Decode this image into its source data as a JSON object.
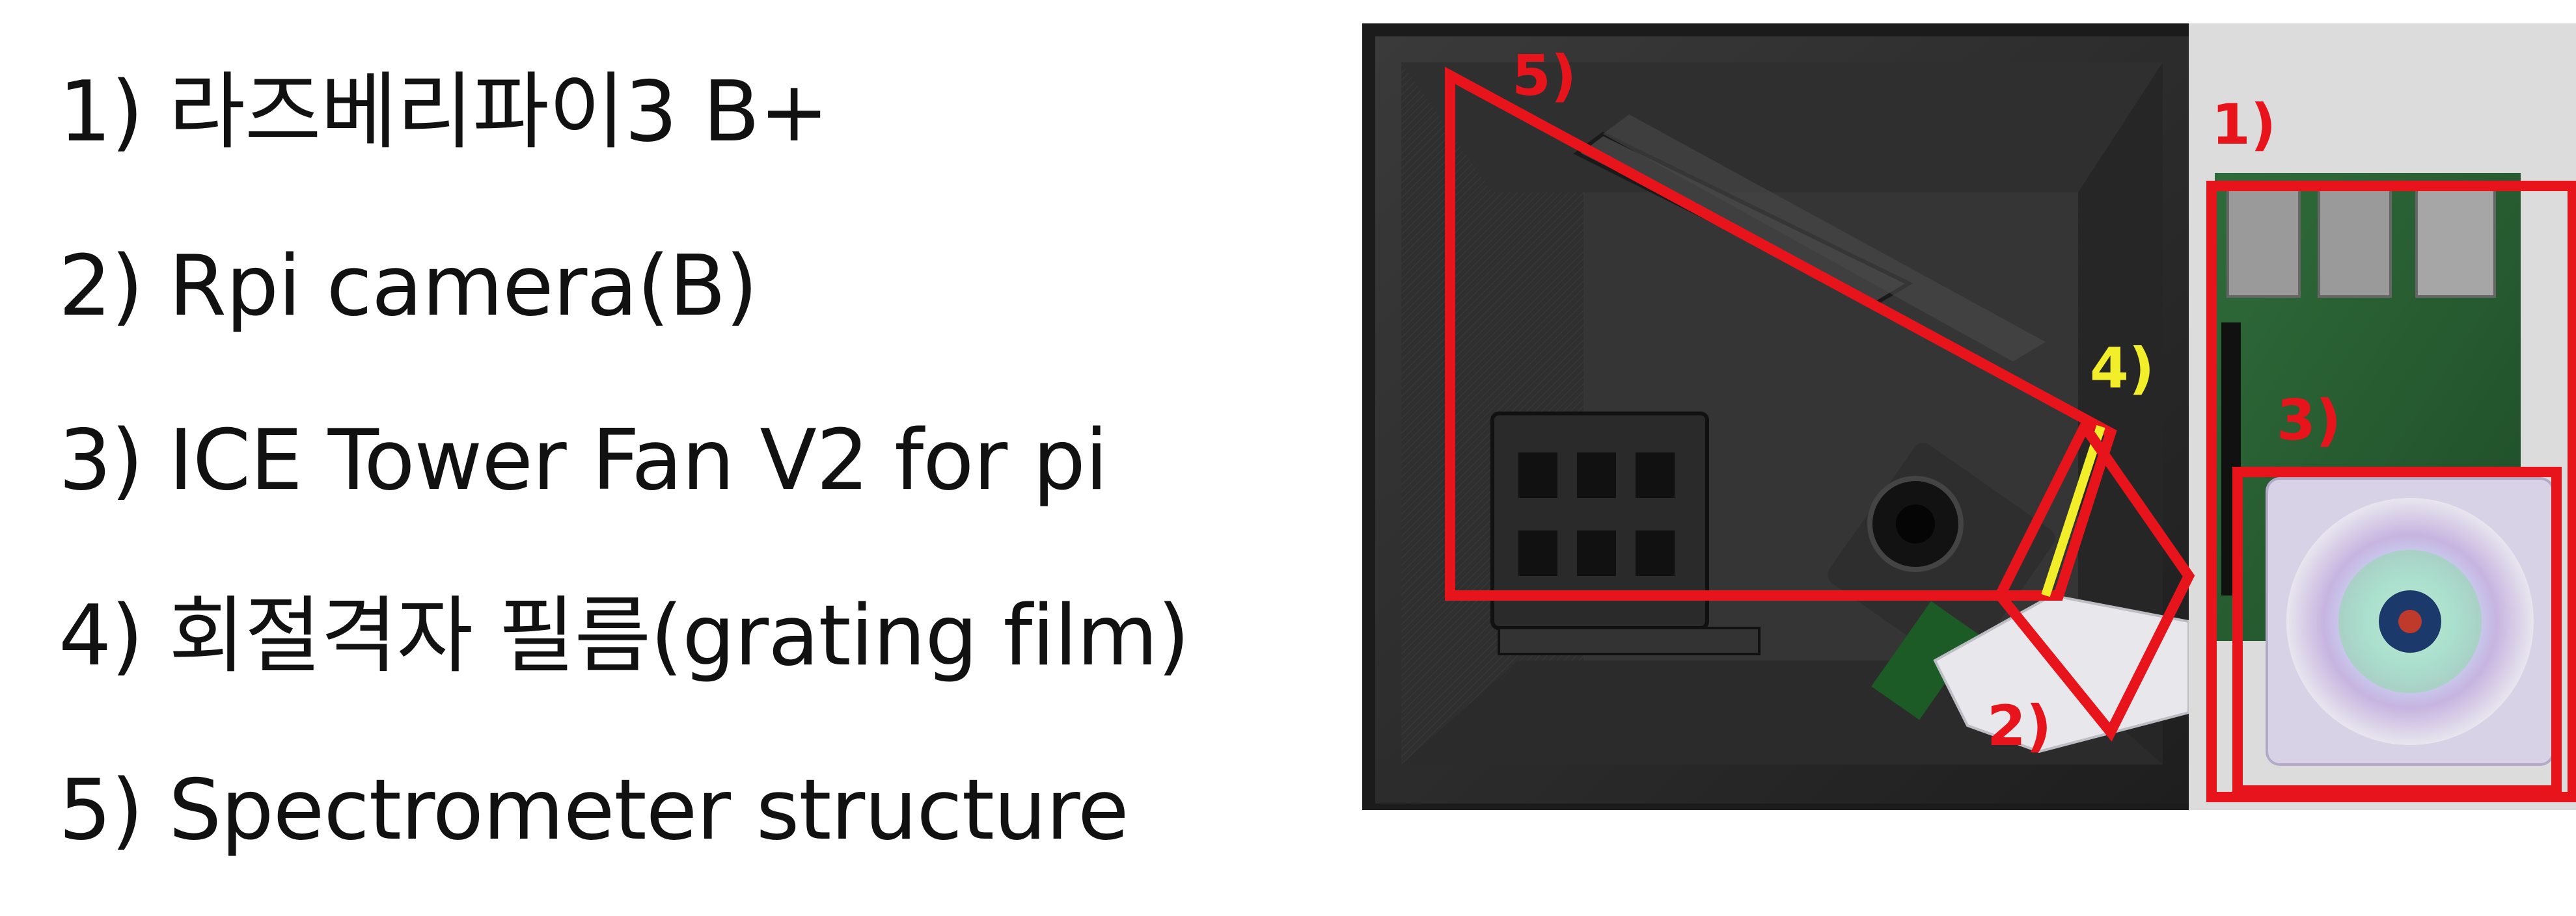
{
  "legend": {
    "items": [
      {
        "text": "1) 라즈베리파이3 B+"
      },
      {
        "text": "2) Rpi camera(B)"
      },
      {
        "text": "3) ICE Tower Fan V2 for pi"
      },
      {
        "text": "4) 회절격자  필름(grating film)"
      },
      {
        "text": "5) Spectrometer structure"
      }
    ]
  },
  "photo": {
    "callouts": [
      {
        "label": "1)",
        "color": "#e8141b"
      },
      {
        "label": "2)",
        "color": "#e8141b"
      },
      {
        "label": "3)",
        "color": "#e8141b"
      },
      {
        "label": "4)",
        "color": "#f2ee2a"
      },
      {
        "label": "5)",
        "color": "#e8141b"
      }
    ]
  },
  "colors": {
    "highlight_red": "#e8141b",
    "highlight_yellow": "#f2ee2a",
    "housing_dark": "#2a2a2a",
    "text": "#111111"
  }
}
